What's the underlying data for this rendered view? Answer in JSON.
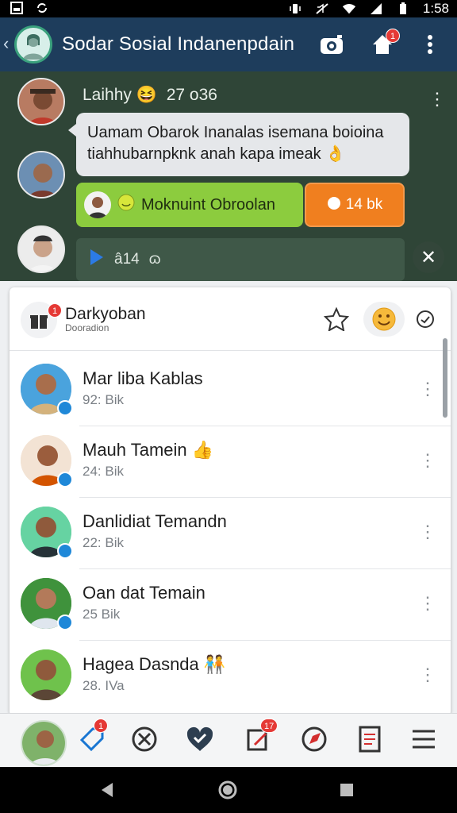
{
  "status_bar": {
    "time": "1:58",
    "left_icons": [
      "notification-icon",
      "sync-icon"
    ],
    "right_icons": [
      "vibrate-icon",
      "mute-icon",
      "wifi-icon",
      "signal-icon",
      "battery-icon"
    ]
  },
  "app_bar": {
    "back": "‹",
    "title": "Sodar Sosial Indanenpdain",
    "actions": [
      {
        "icon": "camera-icon",
        "badge": ""
      },
      {
        "icon": "home-notification-icon",
        "badge": "1"
      },
      {
        "icon": "more-vertical-icon",
        "badge": ""
      }
    ]
  },
  "chat": {
    "sender_name": "Laihhy",
    "sender_emoji": "😆",
    "sender_meta": "27 o36",
    "message": "Uamam Obarok Inanalas isemana boioina tiahhubarnpknk anah kapa imeak 👌",
    "green_button_label": "Moknuint Obroolan",
    "orange_button_label": "14 bk",
    "voice_text": "â14",
    "voice_suffix": "ɷ",
    "close": "✕"
  },
  "panel": {
    "title": "Darkyoban",
    "subtitle": "Dooradion",
    "header_badge": "1",
    "actions": [
      "star-icon",
      "emoji-icon",
      "refresh-icon"
    ]
  },
  "contacts": [
    {
      "name": "Mar liba Kablas",
      "time": "92: Bik"
    },
    {
      "name": "Mauh Tamein 👍",
      "time": "24: Bik"
    },
    {
      "name": "Danlidiat Temandn",
      "time": "22: Bik"
    },
    {
      "name": "Oan dat Temain",
      "time": "25 Bik"
    },
    {
      "name": "Hagea Dasnda 🧑‍🤝‍🧑",
      "time": "28. IVa"
    }
  ],
  "bottom_nav": {
    "items": [
      {
        "icon": "profile-avatar-icon",
        "badge": ""
      },
      {
        "icon": "tag-icon",
        "badge": "1"
      },
      {
        "icon": "compass-tools-icon",
        "badge": ""
      },
      {
        "icon": "heart-chat-icon",
        "badge": ""
      },
      {
        "icon": "edit-notify-icon",
        "badge": "17"
      },
      {
        "icon": "explore-icon",
        "badge": ""
      },
      {
        "icon": "document-icon",
        "badge": ""
      },
      {
        "icon": "menu-icon",
        "badge": ""
      }
    ]
  },
  "colors": {
    "app_bar": "#1e3d5c",
    "chat_bg": "#2f4537",
    "green": "#8ccc3e",
    "orange": "#f07f1f",
    "badge": "#e53935",
    "verified": "#1f88d8"
  }
}
